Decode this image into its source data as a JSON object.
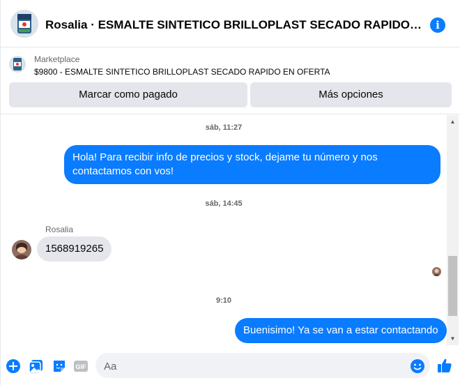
{
  "header": {
    "title": "Rosalia · ESMALTE SINTETICO BRILLOPLAST SECADO RAPIDO EN O..."
  },
  "marketplace": {
    "label": "Marketplace",
    "item": "$9800 - ESMALTE SINTETICO BRILLOPLAST SECADO RAPIDO EN OFERTA",
    "mark_paid_label": "Marcar como pagado",
    "more_options_label": "Más opciones"
  },
  "messages": {
    "ts1": "sáb, 11:27",
    "out1": "Hola! Para recibir info de precios y stock, dejame tu número y nos contactamos con vos!",
    "ts2": "sáb, 14:45",
    "sender": "Rosalia",
    "in1": "1568919265",
    "ts3": "9:10",
    "out2": "Buenisimo! Ya se van a estar contactando"
  },
  "composer": {
    "placeholder": "Aa",
    "gif_label": "GIF"
  },
  "colors": {
    "accent": "#0a7cff",
    "bubble_in": "#e4e6eb",
    "muted": "#65676b"
  }
}
